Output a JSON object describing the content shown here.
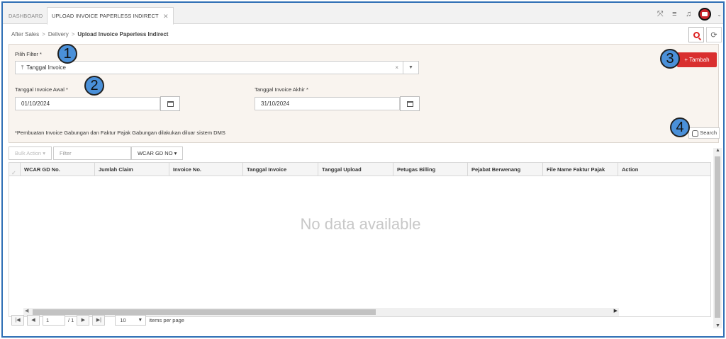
{
  "tabs": [
    {
      "label": "DASHBOARD",
      "active": false
    },
    {
      "label": "UPLOAD INVOICE PAPERLESS INDIRECT",
      "active": true,
      "close": "✕"
    }
  ],
  "breadcrumb": [
    "After Sales",
    "Delivery",
    "Upload Invoice Paperless Indirect"
  ],
  "breadcrumb_separator": ">",
  "filter": {
    "pilih_filter_label": "Pilih Filter *",
    "pilih_filter_value": "Tanggal Invoice",
    "clear_symbol": "×",
    "tanggal_awal_label": "Tanggal Invoice Awal *",
    "tanggal_awal_value": "01/10/2024",
    "tanggal_akhir_label": "Tanggal Invoice Akhir *",
    "tanggal_akhir_value": "31/10/2024",
    "note": "*Pembuatan Invoice Gabungan dan Faktur Pajak Gabungan dilakukan diluar sistem DMS",
    "tambah_label": "+ Tambah",
    "search_label": "Search"
  },
  "markers": [
    "1",
    "2",
    "3",
    "4"
  ],
  "toolbar": {
    "bulk_action": "Bulk Action ▾",
    "filter_placeholder": "Filter",
    "wcar_dropdown": "WCAR GD NO ▾"
  },
  "grid": {
    "columns": [
      "WCAR GD No.",
      "Jumlah Claim",
      "Invoice No.",
      "Tanggal Invoice",
      "Tanggal Upload",
      "Petugas Billing",
      "Pejabat Berwenang",
      "File Name Faktur Pajak",
      "Action"
    ],
    "empty_message": "No data available"
  },
  "pager": {
    "first": "|◀",
    "prev": "◀",
    "page": "1",
    "of_pages": "/ 1",
    "next": "▶",
    "last": "▶|",
    "page_size": "10",
    "items_per_page": "items per page"
  },
  "colors": {
    "accent": "#d92f2f",
    "marker": "#4a90d9",
    "panel_bg": "#f9f4ef",
    "frame_border": "#2f6fb5"
  },
  "icons": [
    "expand-icon",
    "menu-icon",
    "bell-icon",
    "avatar-icon",
    "chevron-down-icon",
    "search-icon",
    "refresh-icon",
    "pin-icon",
    "calendar-icon",
    "database-icon"
  ]
}
